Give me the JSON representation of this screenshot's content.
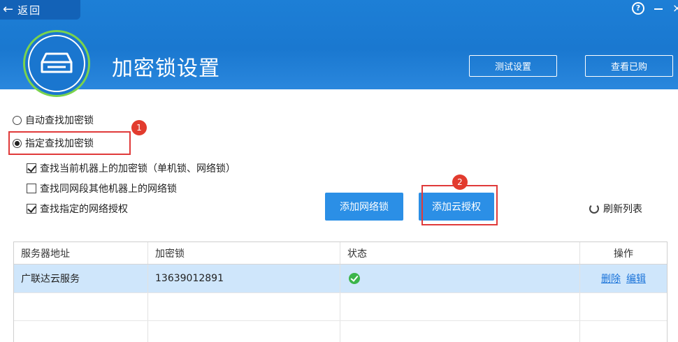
{
  "header": {
    "back_label": "返回",
    "title": "加密锁设置",
    "test_settings_label": "测试设置",
    "view_purchased_label": "查看已购",
    "help_glyph": "?"
  },
  "options": {
    "radio_auto": "自动查找加密锁",
    "radio_specified": "指定查找加密锁",
    "radio_selected": "specified",
    "check_current": {
      "label": "查找当前机器上的加密锁（单机锁、网络锁）",
      "checked": true
    },
    "check_same_segment": {
      "label": "查找同网段其他机器上的网络锁",
      "checked": false
    },
    "check_specified_auth": {
      "label": "查找指定的网络授权",
      "checked": true
    }
  },
  "actions": {
    "add_network_lock": "添加网络锁",
    "add_cloud_auth": "添加云授权",
    "refresh_list": "刷新列表"
  },
  "annotations": {
    "badge1": "1",
    "badge2": "2"
  },
  "table": {
    "columns": [
      "服务器地址",
      "加密锁",
      "状态",
      "操作"
    ],
    "rows": [
      {
        "server": "广联达云服务",
        "lock": "13639012891",
        "status": "ok",
        "delete": "删除",
        "edit": "编辑"
      }
    ]
  },
  "colors": {
    "header_blue": "#1a78d0",
    "accent_green": "#7ad34d",
    "button_blue": "#2b8fe6",
    "highlight_red": "#e03a3a",
    "row_selected": "#cfe6fb"
  }
}
